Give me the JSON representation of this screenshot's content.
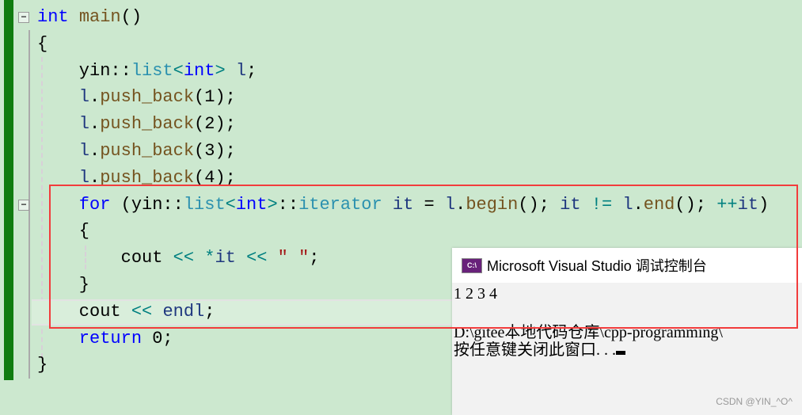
{
  "editor": {
    "lines": [
      [
        [
          "int ",
          "kw"
        ],
        [
          "main",
          "fn"
        ],
        [
          "()",
          "pl"
        ]
      ],
      [
        [
          "{",
          "pl"
        ]
      ],
      [
        [
          "    yin::",
          "pl"
        ],
        [
          "list",
          "ty"
        ],
        [
          "<",
          "op"
        ],
        [
          "int",
          "kw"
        ],
        [
          "> ",
          "op"
        ],
        [
          "l",
          "var"
        ],
        [
          ";",
          "pl"
        ]
      ],
      [
        [
          "    l",
          "var"
        ],
        [
          ".",
          "pl"
        ],
        [
          "push_back",
          "fn"
        ],
        [
          "(1);",
          "pl"
        ]
      ],
      [
        [
          "    l",
          "var"
        ],
        [
          ".",
          "pl"
        ],
        [
          "push_back",
          "fn"
        ],
        [
          "(2);",
          "pl"
        ]
      ],
      [
        [
          "    l",
          "var"
        ],
        [
          ".",
          "pl"
        ],
        [
          "push_back",
          "fn"
        ],
        [
          "(3);",
          "pl"
        ]
      ],
      [
        [
          "    l",
          "var"
        ],
        [
          ".",
          "pl"
        ],
        [
          "push_back",
          "fn"
        ],
        [
          "(4);",
          "pl"
        ]
      ],
      [
        [
          "    for ",
          "kw"
        ],
        [
          "(yin::",
          "pl"
        ],
        [
          "list",
          "ty"
        ],
        [
          "<",
          "op"
        ],
        [
          "int",
          "kw"
        ],
        [
          ">",
          "op"
        ],
        [
          "::",
          "pl"
        ],
        [
          "iterator ",
          "ty"
        ],
        [
          "it ",
          "var"
        ],
        [
          "= ",
          "pl"
        ],
        [
          "l",
          "var"
        ],
        [
          ".",
          "pl"
        ],
        [
          "begin",
          "fn"
        ],
        [
          "(); ",
          "pl"
        ],
        [
          "it ",
          "var"
        ],
        [
          "!= ",
          "op"
        ],
        [
          "l",
          "var"
        ],
        [
          ".",
          "pl"
        ],
        [
          "end",
          "fn"
        ],
        [
          "(); ",
          "pl"
        ],
        [
          "++",
          "op"
        ],
        [
          "it",
          "var"
        ],
        [
          ")",
          "pl"
        ]
      ],
      [
        [
          "    {",
          "pl"
        ]
      ],
      [
        [
          "        cout ",
          "pl"
        ],
        [
          "<< ",
          "op"
        ],
        [
          "*",
          "op"
        ],
        [
          "it ",
          "var"
        ],
        [
          "<< ",
          "op"
        ],
        [
          "\" \"",
          "str"
        ],
        [
          ";",
          "pl"
        ]
      ],
      [
        [
          "    }",
          "pl"
        ]
      ],
      [
        [
          "    cout ",
          "pl"
        ],
        [
          "<< ",
          "op"
        ],
        [
          "endl",
          "var"
        ],
        [
          ";",
          "pl"
        ]
      ],
      [
        [
          "    return ",
          "kw"
        ],
        [
          "0;",
          "pl"
        ]
      ],
      [
        [
          "}",
          "pl"
        ]
      ]
    ]
  },
  "console": {
    "title": "Microsoft Visual Studio 调试控制台",
    "icon_text": "C:\\",
    "output": [
      "1 2 3 4",
      "",
      "D:\\gitee本地代码仓库\\cpp-programming\\",
      "按任意键关闭此窗口. . ."
    ]
  },
  "watermark": "CSDN @YIN_^O^"
}
